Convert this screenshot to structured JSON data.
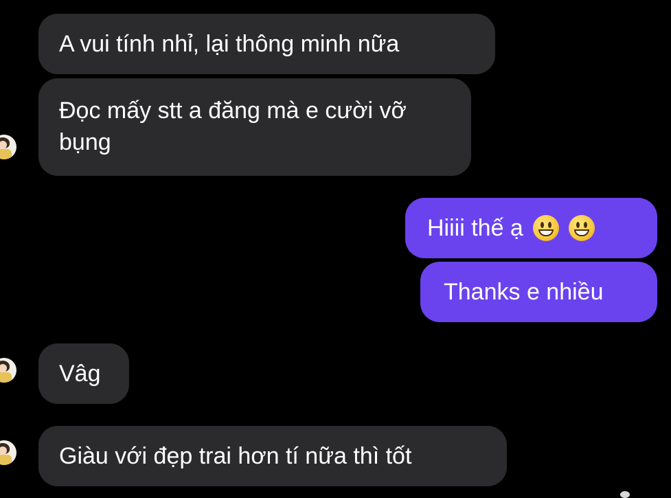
{
  "messages": [
    {
      "direction": "incoming",
      "text": "A vui tính nhỉ, lại thông minh nữa"
    },
    {
      "direction": "incoming",
      "text": "Đọc mấy stt a đăng mà e cười vỡ bụng"
    },
    {
      "direction": "outgoing",
      "text": "Hiiii thế ạ",
      "emojis": [
        "grinning-face-icon",
        "grinning-face-icon"
      ]
    },
    {
      "direction": "outgoing",
      "text": "Thanks e nhiều"
    },
    {
      "direction": "incoming",
      "text": "Vâg"
    },
    {
      "direction": "incoming",
      "text": "Giàu với đẹp trai hơn tí nữa thì tốt"
    }
  ],
  "colors": {
    "background": "#000000",
    "incoming_bubble": "#2b2b2d",
    "outgoing_bubble": "#6a43ee",
    "text": "#ffffff"
  }
}
